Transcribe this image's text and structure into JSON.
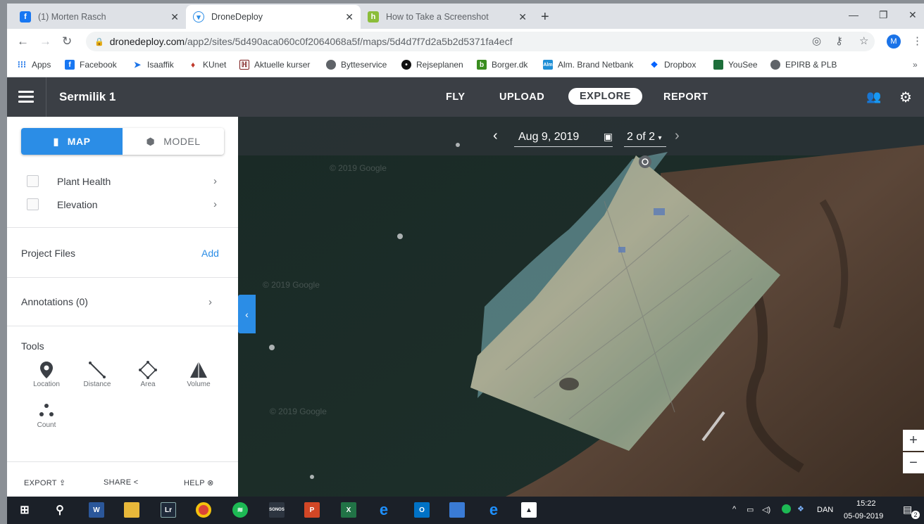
{
  "browser": {
    "tabs": [
      {
        "label": "(1) Morten Rasch",
        "icon": "facebook-icon",
        "color": "#1877f2"
      },
      {
        "label": "DroneDeploy",
        "icon": "dronedeploy-icon",
        "color": "#2b8de6"
      },
      {
        "label": "How to Take a Screenshot",
        "icon": "howtogeek-icon",
        "color": "#8bbd3a"
      }
    ],
    "url_domain": "dronedeploy.com",
    "url_path": "/app2/sites/5d490aca060c0f2064068a5f/maps/5d4d7f7d2a5b2d5371fa4ecf",
    "profile_initial": "M",
    "bookmarks": [
      {
        "label": "Apps",
        "icon": "apps-grid-icon"
      },
      {
        "label": "Facebook",
        "icon": "facebook-icon"
      },
      {
        "label": "Isaaffik",
        "icon": "isaaffik-icon"
      },
      {
        "label": "KUnet",
        "icon": "kunet-icon"
      },
      {
        "label": "Aktuelle kurser",
        "icon": "kurser-icon"
      },
      {
        "label": "Bytteservice",
        "icon": "globe-icon"
      },
      {
        "label": "Rejseplanen",
        "icon": "rejseplanen-icon"
      },
      {
        "label": "Borger.dk",
        "icon": "borger-icon"
      },
      {
        "label": "Alm. Brand Netbank",
        "icon": "almbrand-icon"
      },
      {
        "label": "Dropbox",
        "icon": "dropbox-icon"
      },
      {
        "label": "YouSee",
        "icon": "yousee-icon"
      },
      {
        "label": "EPIRB & PLB",
        "icon": "globe-icon"
      }
    ]
  },
  "app": {
    "site_name": "Sermilik 1",
    "nav": [
      "FLY",
      "UPLOAD",
      "EXPLORE",
      "REPORT"
    ],
    "active_nav": "EXPLORE",
    "accent": "#2b8de6",
    "header_bg": "#3b3f45"
  },
  "sidebar": {
    "view_modes": [
      "MAP",
      "MODEL"
    ],
    "active_mode": "MAP",
    "layers": [
      {
        "label": "Plant Health",
        "checked": false
      },
      {
        "label": "Elevation",
        "checked": false
      }
    ],
    "project_files_label": "Project Files",
    "add_label": "Add",
    "annotations_label": "Annotations (0)",
    "tools_label": "Tools",
    "tools": [
      {
        "label": "Location",
        "icon": "location-pin-icon"
      },
      {
        "label": "Distance",
        "icon": "ruler-line-icon"
      },
      {
        "label": "Area",
        "icon": "polygon-area-icon"
      },
      {
        "label": "Volume",
        "icon": "volume-pyramid-icon"
      },
      {
        "label": "Count",
        "icon": "count-dots-icon"
      }
    ],
    "footer": {
      "export": "EXPORT",
      "share": "SHARE",
      "help": "HELP"
    }
  },
  "map": {
    "date": "Aug 9, 2019",
    "page_indicator": "2 of 2",
    "watermark": "© 2019 Google",
    "zoom_in": "+",
    "zoom_out": "−"
  },
  "taskbar": {
    "language": "DAN",
    "time": "15:22",
    "date": "05-09-2019",
    "notifications": "2"
  }
}
